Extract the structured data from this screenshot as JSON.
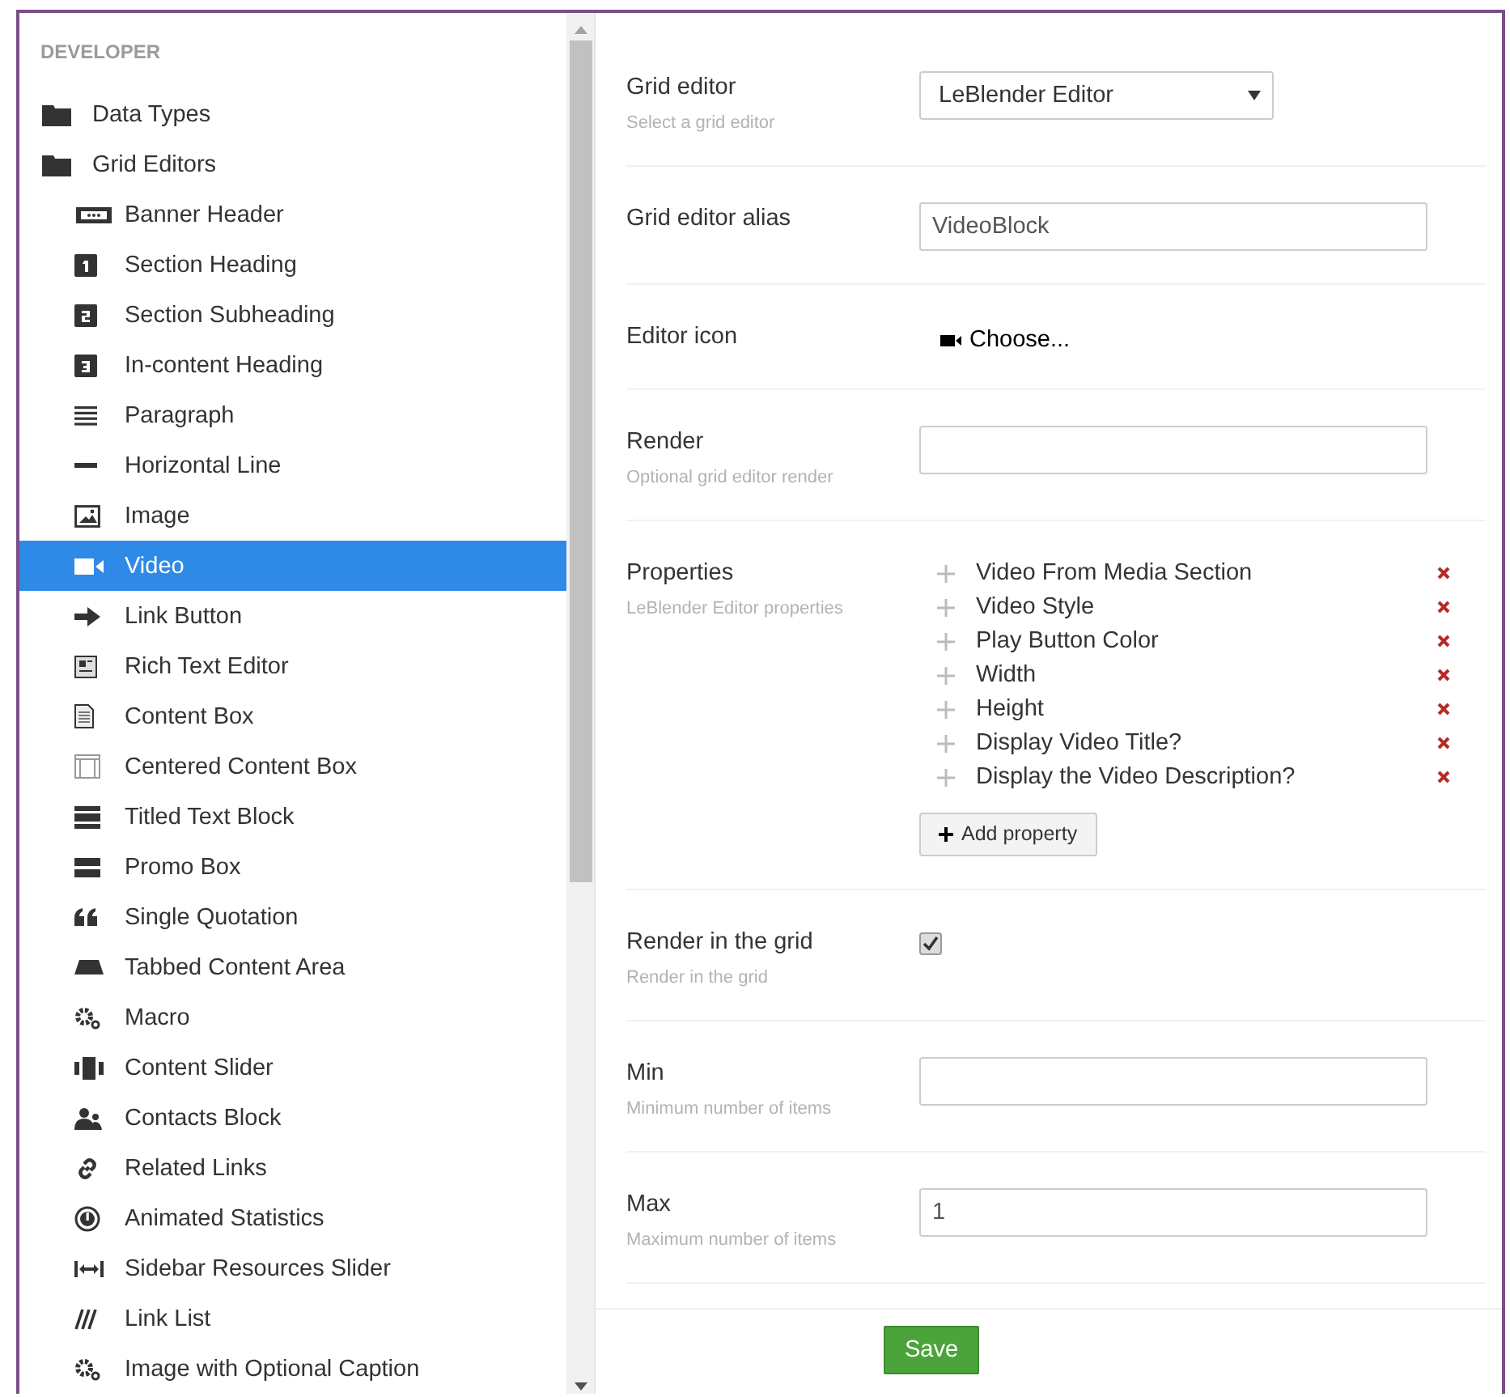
{
  "sidebar": {
    "title": "DEVELOPER",
    "items": [
      {
        "label": "Data Types",
        "selected": false
      },
      {
        "label": "Grid Editors",
        "selected": false,
        "children": [
          {
            "label": "Banner Header",
            "selected": false
          },
          {
            "label": "Section Heading",
            "selected": false
          },
          {
            "label": "Section Subheading",
            "selected": false
          },
          {
            "label": "In-content Heading",
            "selected": false
          },
          {
            "label": "Paragraph",
            "selected": false
          },
          {
            "label": "Horizontal Line",
            "selected": false
          },
          {
            "label": "Image",
            "selected": false
          },
          {
            "label": "Video",
            "selected": true
          },
          {
            "label": "Link Button",
            "selected": false
          },
          {
            "label": "Rich Text Editor",
            "selected": false
          },
          {
            "label": "Content Box",
            "selected": false
          },
          {
            "label": "Centered Content Box",
            "selected": false
          },
          {
            "label": "Titled Text Block",
            "selected": false
          },
          {
            "label": "Promo Box",
            "selected": false
          },
          {
            "label": "Single Quotation",
            "selected": false
          },
          {
            "label": "Tabbed Content Area",
            "selected": false
          },
          {
            "label": "Macro",
            "selected": false
          },
          {
            "label": "Content Slider",
            "selected": false
          },
          {
            "label": "Contacts Block",
            "selected": false
          },
          {
            "label": "Related Links",
            "selected": false
          },
          {
            "label": "Animated Statistics",
            "selected": false
          },
          {
            "label": "Sidebar Resources Slider",
            "selected": false
          },
          {
            "label": "Link List",
            "selected": false
          },
          {
            "label": "Image with Optional Caption",
            "selected": false
          }
        ]
      }
    ]
  },
  "form": {
    "rows": [
      {
        "kind": "select",
        "label": "Grid editor",
        "description": "Select a grid editor",
        "value": "LeBlender Editor"
      },
      {
        "kind": "text",
        "label": "Grid editor alias",
        "value": "VideoBlock"
      },
      {
        "kind": "icon",
        "label": "Editor icon",
        "value": "Choose..."
      },
      {
        "kind": "text",
        "label": "Render",
        "description": "Optional grid editor render"
      },
      {
        "kind": "properties",
        "label": "Properties",
        "description": "LeBlender Editor properties",
        "items": [
          "Video From Media Section",
          "Video Style",
          "Play Button Color",
          "Width",
          "Height",
          "Display Video Title?",
          "Display the Video Description?"
        ],
        "add_button": "Add property"
      },
      {
        "kind": "checkbox",
        "label": "Render in the grid",
        "description": "Render in the grid",
        "checked": true
      },
      {
        "kind": "text",
        "label": "Min",
        "description": "Minimum number of items"
      },
      {
        "kind": "text",
        "label": "Max",
        "description": "Maximum number of items",
        "value": "1"
      }
    ],
    "save_button": "Save"
  }
}
